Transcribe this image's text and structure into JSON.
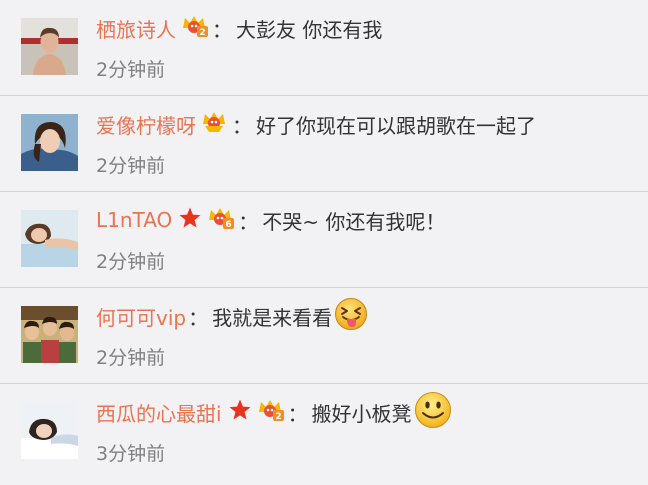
{
  "comments": [
    {
      "username": "栖旅诗人",
      "colon": "：",
      "text": "大彭友 你还有我",
      "time": "2分钟前",
      "badge_number": "2",
      "has_star": false,
      "emoji": null,
      "avatar": "boy-shirtless-icon"
    },
    {
      "username": "爱像柠檬呀",
      "colon": "：",
      "text": "好了你现在可以跟胡歌在一起了",
      "time": "2分钟前",
      "badge_number": "",
      "has_star": false,
      "emoji": null,
      "avatar": "girl-portrait-icon"
    },
    {
      "username": "L1nTAO",
      "colon": "：",
      "text": "不哭~ 你还有我呢！",
      "time": "2分钟前",
      "badge_number": "6",
      "has_star": true,
      "emoji": null,
      "avatar": "woman-lying-icon"
    },
    {
      "username": "何可可vip",
      "colon": "：",
      "text": "我就是来看看",
      "time": "2分钟前",
      "badge_number": null,
      "has_star": false,
      "emoji": "tongue-squint-emoji",
      "avatar": "group-photo-icon"
    },
    {
      "username": "西瓜的心最甜i",
      "colon": "：",
      "text": "搬好小板凳",
      "time": "3分钟前",
      "badge_number": "2",
      "has_star": true,
      "emoji": "smile-emoji",
      "avatar": "girl-in-bed-icon"
    }
  ],
  "colors": {
    "background": "#f2f2f5",
    "username": "#eb7350",
    "text": "#333333",
    "time": "#808080",
    "divider": "#d4d4d8",
    "badge_gold": "#f5b700",
    "badge_red": "#e8502f",
    "star_red": "#e8341f"
  }
}
